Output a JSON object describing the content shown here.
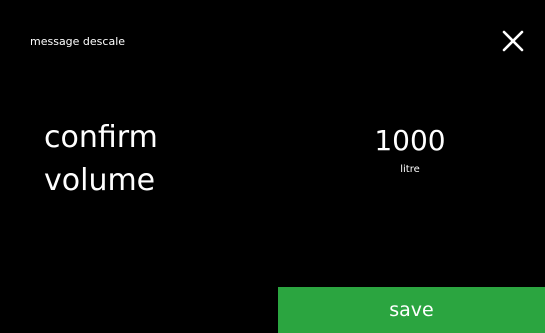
{
  "header": {
    "title": "message descale"
  },
  "icons": {
    "close": "close-icon"
  },
  "main": {
    "prompt_line1": "confirm",
    "prompt_line2": "volume",
    "value": "1000",
    "unit": "litre"
  },
  "footer": {
    "save_label": "save"
  },
  "colors": {
    "background": "#000000",
    "text": "#ffffff",
    "save_button": "#2ba540"
  }
}
